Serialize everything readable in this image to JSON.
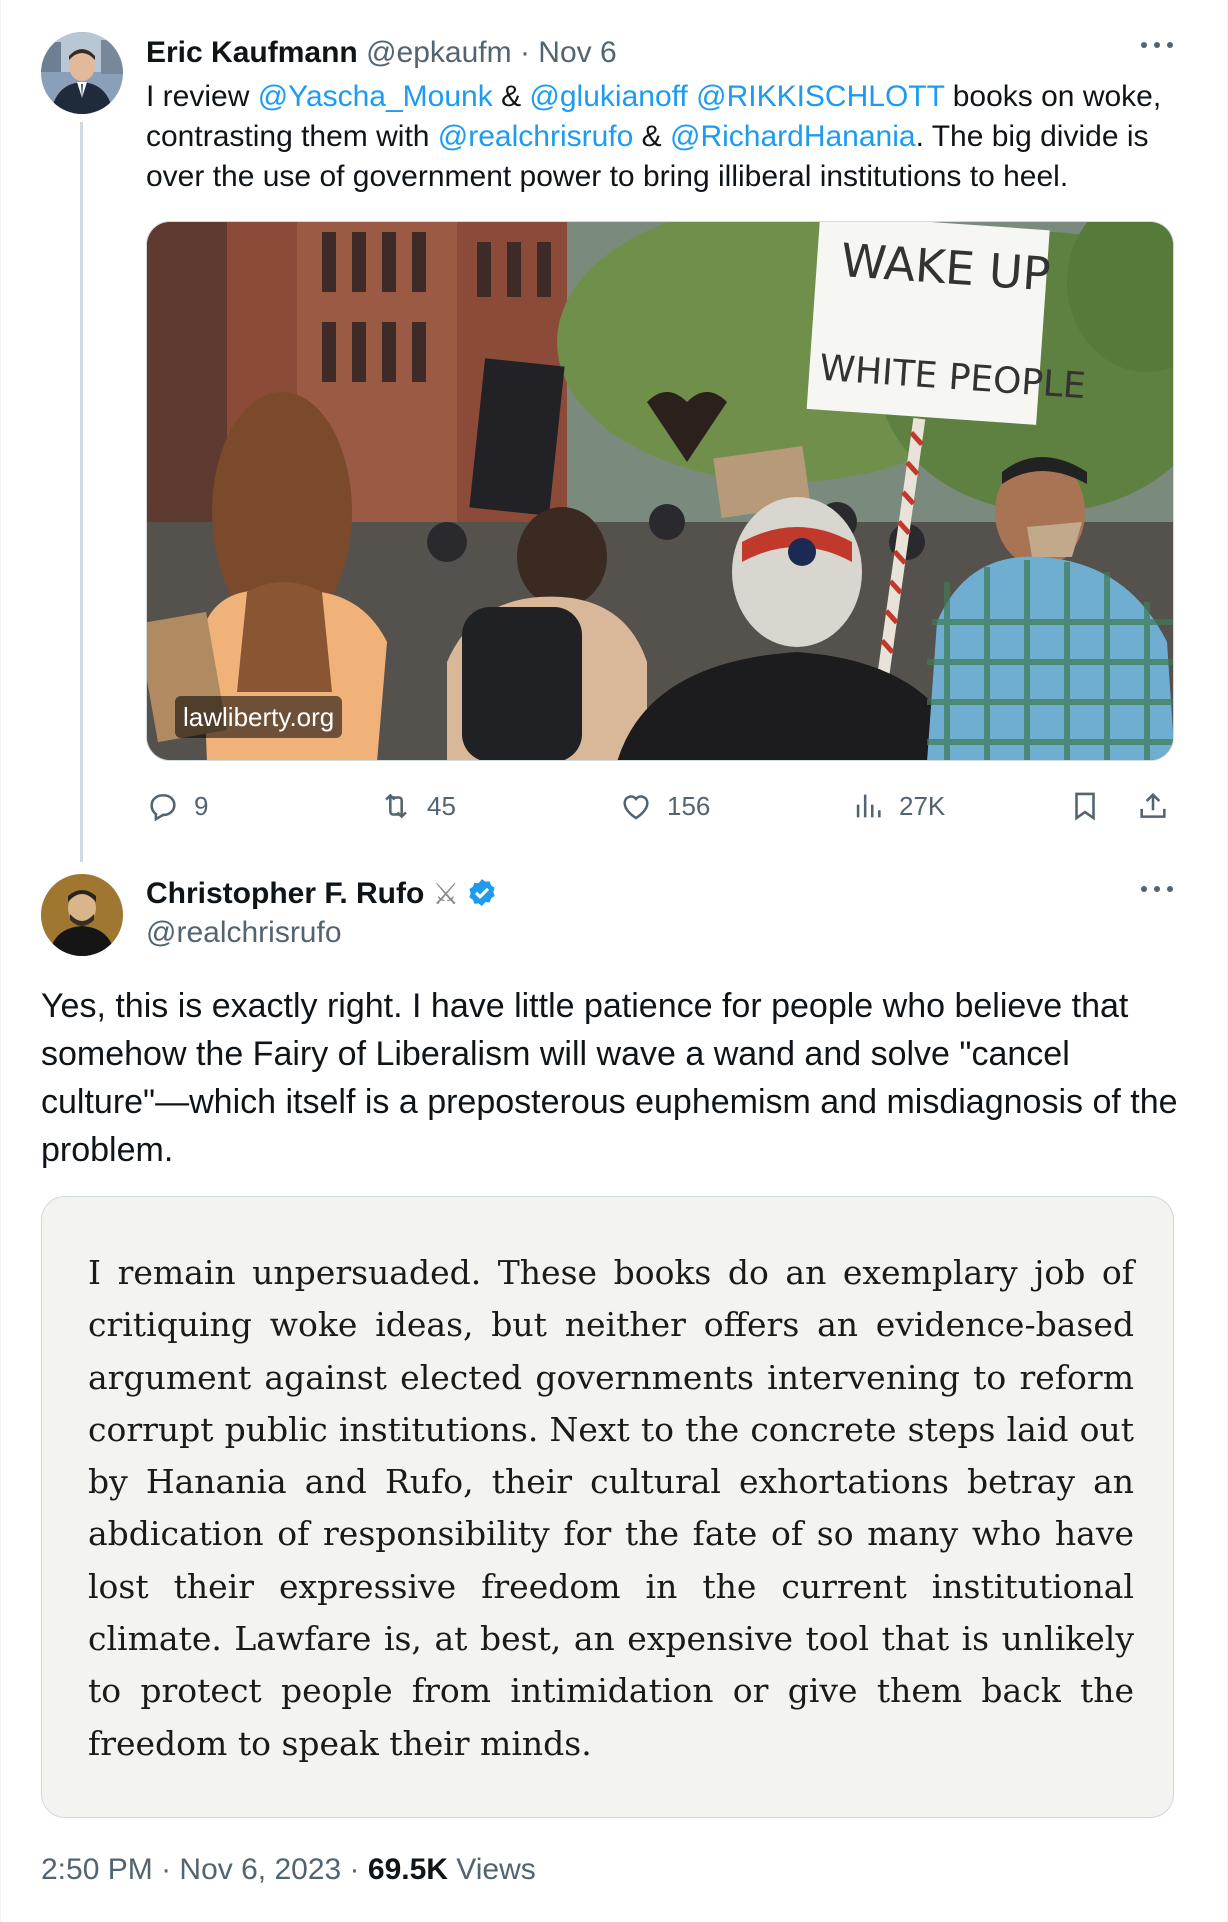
{
  "parent_tweet": {
    "author_name": "Eric Kaufmann",
    "author_handle": "@epkaufm",
    "separator": "·",
    "date": "Nov 6",
    "text_segments": [
      {
        "text": "I review ",
        "mention": false
      },
      {
        "text": "@Yascha_Mounk",
        "mention": true
      },
      {
        "text": " & ",
        "mention": false
      },
      {
        "text": "@glukianoff",
        "mention": true
      },
      {
        "text": " ",
        "mention": false
      },
      {
        "text": "@RIKKISCHLOTT",
        "mention": true
      },
      {
        "text": " books on woke, contrasting them with ",
        "mention": false
      },
      {
        "text": "@realchrisrufo",
        "mention": true
      },
      {
        "text": " & ",
        "mention": false
      },
      {
        "text": "@RichardHanania",
        "mention": true
      },
      {
        "text": ". The big divide is over the use of government power to bring illiberal institutions to heel.",
        "mention": false
      }
    ],
    "media": {
      "link_caption": "lawliberty.org",
      "sign_text_line1": "WAKE UP",
      "sign_text_line2": "WHITE PEOPLE"
    },
    "stats": {
      "replies": "9",
      "reposts": "45",
      "likes": "156",
      "views": "27K"
    }
  },
  "main_tweet": {
    "author_name": "Christopher F. Rufo",
    "author_handle": "@realchrisrufo",
    "badge_icon": "crossed-swords-icon",
    "verified_icon": "verified-badge-icon",
    "text": "Yes, this is exactly right. I have little patience for people who believe that somehow the Fairy of Liberalism will wave a wand and solve \"cancel culture\"—which itself is a preposterous euphemism and misdiagnosis of the problem.",
    "quote_image_text": "I remain unpersuaded. These books do an exemplary job of critiquing woke ideas, but neither offers an evidence-based argument against elected governments intervening to reform corrupt public institutions. Next to the concrete steps laid out by Hanania and Rufo, their cultural exhortations betray an abdication of responsibility for the fate of so many who have lost their expressive freedom in the current institutional climate. Lawfare is, at best, an expensive tool that is unlikely to protect people from intimidation or give them back the freedom to speak their minds.",
    "time": "2:50 PM",
    "date": "Nov 6, 2023",
    "separator": "·",
    "views_count": "69.5K",
    "views_label": "Views"
  },
  "colors": {
    "text_primary": "#0f1419",
    "text_secondary": "#536471",
    "link": "#1d9bf0",
    "border": "#cfd9de",
    "quote_background": "#f3f3ef",
    "verified": "#1d9bf0"
  }
}
